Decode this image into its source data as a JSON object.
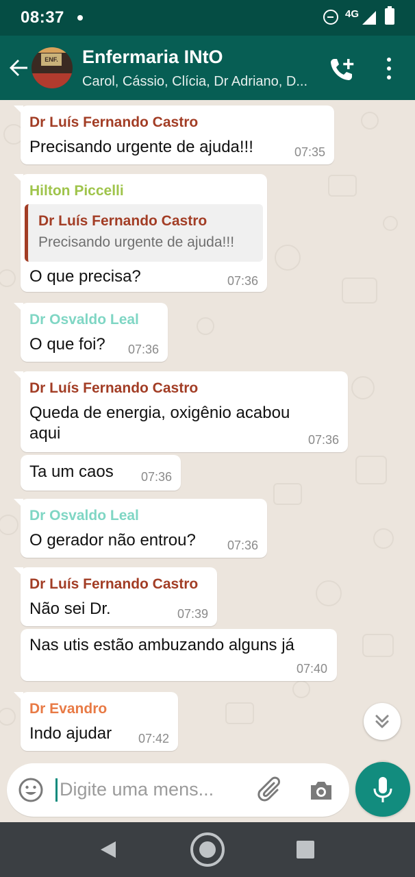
{
  "status_bar": {
    "time": "08:37",
    "network": "4G",
    "icons": [
      "notification-dot-icon",
      "do-not-disturb-icon",
      "signal-icon",
      "battery-icon"
    ]
  },
  "header": {
    "title": "Enfermaria INtO",
    "subtitle": "Carol, Cássio, Clícia, Dr Adriano, D...",
    "avatar_label": "ENF.",
    "icons": [
      "back-arrow-icon",
      "group-avatar",
      "add-call-icon",
      "more-vert-icon"
    ]
  },
  "colors": {
    "header": "#075e54",
    "status_bar": "#054d44",
    "chat_bg": "#ece5dd",
    "accent": "#128c7e",
    "sender_castro": "#a23d25",
    "sender_piccelli": "#9fc44b",
    "sender_leal": "#7fd6c4",
    "sender_evandro": "#e87a45"
  },
  "messages": [
    {
      "sender": "Dr Luís Fernando Castro",
      "text": "Precisando urgente de ajuda!!!",
      "time": "07:35"
    },
    {
      "sender": "Hilton Piccelli",
      "quote_sender": "Dr Luís Fernando Castro",
      "quote_text": "Precisando urgente de ajuda!!!",
      "text": "O que precisa?",
      "time": "07:36"
    },
    {
      "sender": "Dr Osvaldo Leal",
      "text": "O que foi?",
      "time": "07:36"
    },
    {
      "sender": "Dr Luís Fernando Castro",
      "text_line1": "Queda de energia,  oxigênio acabou",
      "text_line2": "aqui",
      "time": "07:36"
    },
    {
      "text": "Ta um caos",
      "time": "07:36"
    },
    {
      "sender": "Dr Osvaldo Leal",
      "text": "O gerador não entrou?",
      "time": "07:36"
    },
    {
      "sender": "Dr Luís Fernando Castro",
      "text": "Não sei Dr.",
      "time": "07:39"
    },
    {
      "text": "Nas utis estão ambuzando alguns já",
      "time": "07:40"
    },
    {
      "sender": "Dr Evandro",
      "text": "Indo ajudar",
      "time": "07:42"
    }
  ],
  "input": {
    "placeholder": "Digite uma mens...",
    "icons": [
      "emoji-icon",
      "attach-icon",
      "camera-icon",
      "mic-icon"
    ]
  },
  "scroll_down_icon": "double-chevron-down-icon",
  "nav_bar": {
    "icons": [
      "nav-back-icon",
      "nav-home-icon",
      "nav-recents-icon"
    ]
  }
}
